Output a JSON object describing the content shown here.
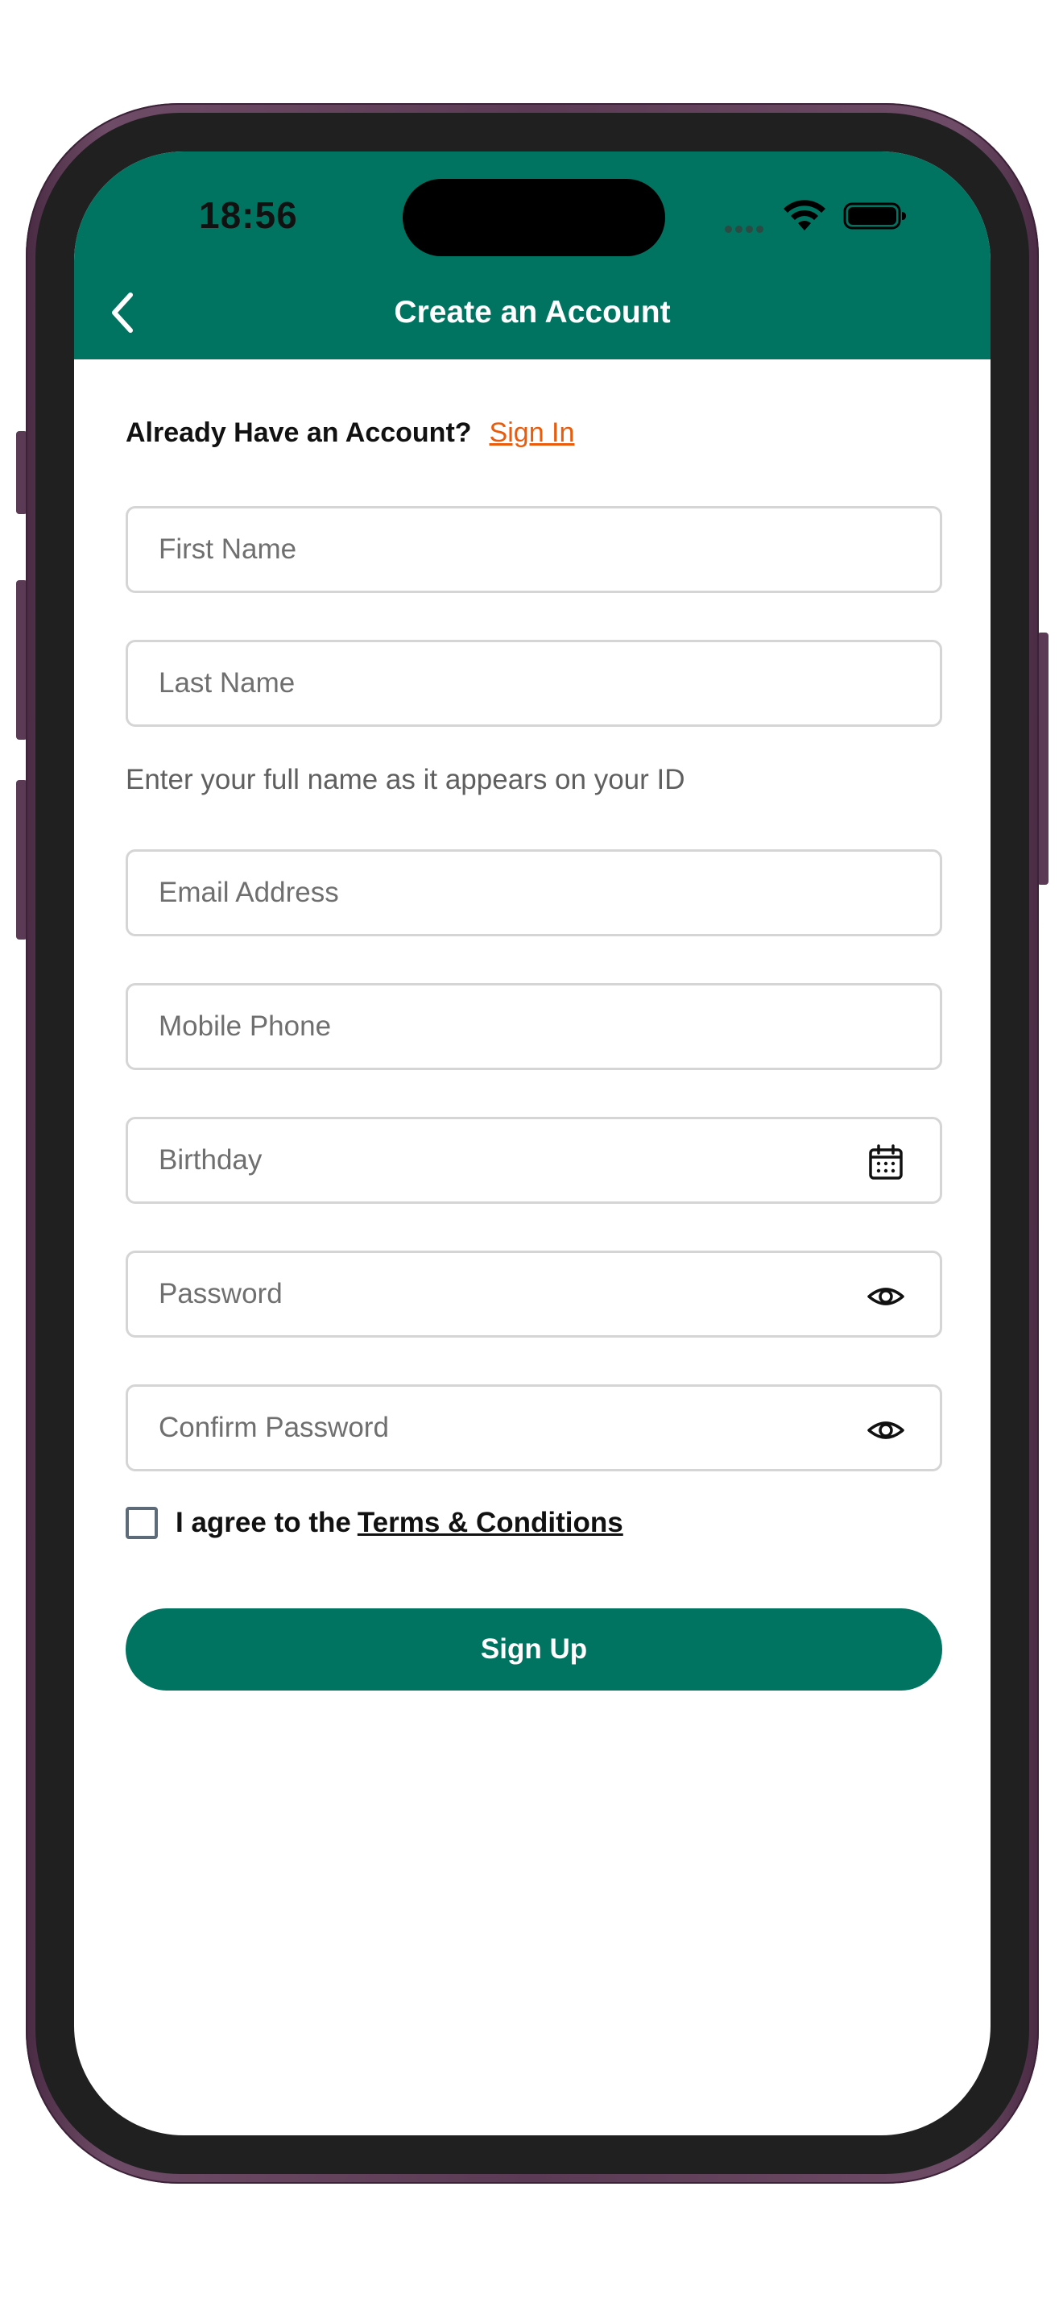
{
  "status_bar": {
    "time": "18:56"
  },
  "header": {
    "title": "Create an Account",
    "background_color": "#017461"
  },
  "signin": {
    "prompt": "Already Have an Account?",
    "link_label": "Sign In",
    "link_color": "#ea5b0c"
  },
  "form": {
    "first_name": {
      "placeholder": "First Name",
      "value": ""
    },
    "last_name": {
      "placeholder": "Last Name",
      "value": ""
    },
    "name_hint": "Enter your full name as it appears on your ID",
    "email": {
      "placeholder": "Email Address",
      "value": ""
    },
    "mobile_phone": {
      "placeholder": "Mobile Phone",
      "value": ""
    },
    "birthday": {
      "placeholder": "Birthday",
      "value": "",
      "icon": "calendar-icon"
    },
    "password": {
      "placeholder": "Password",
      "value": "",
      "icon": "eye-icon"
    },
    "confirm_password": {
      "placeholder": "Confirm Password",
      "value": "",
      "icon": "eye-icon"
    }
  },
  "terms": {
    "checked": false,
    "text": "I agree to the",
    "link_label": "Terms & Conditions"
  },
  "submit": {
    "label": "Sign Up",
    "color": "#017461"
  }
}
